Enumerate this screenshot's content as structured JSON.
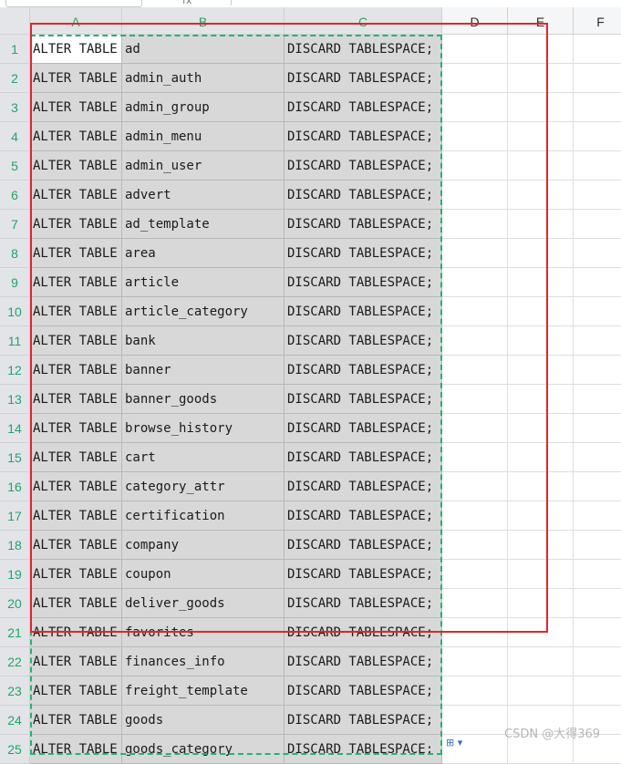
{
  "toolbar": {
    "name_box": "",
    "fx_label": "fx",
    "formula_value": ""
  },
  "columns": [
    "A",
    "B",
    "C",
    "D",
    "E",
    "F"
  ],
  "rows": [
    {
      "num": "1",
      "a": "ALTER TABLE",
      "b": "ad",
      "c": "DISCARD TABLESPACE;"
    },
    {
      "num": "2",
      "a": "ALTER TABLE",
      "b": "admin_auth",
      "c": "DISCARD TABLESPACE;"
    },
    {
      "num": "3",
      "a": "ALTER TABLE",
      "b": "admin_group",
      "c": "DISCARD TABLESPACE;"
    },
    {
      "num": "4",
      "a": "ALTER TABLE",
      "b": "admin_menu",
      "c": "DISCARD TABLESPACE;"
    },
    {
      "num": "5",
      "a": "ALTER TABLE",
      "b": "admin_user",
      "c": "DISCARD TABLESPACE;"
    },
    {
      "num": "6",
      "a": "ALTER TABLE",
      "b": "advert",
      "c": "DISCARD TABLESPACE;"
    },
    {
      "num": "7",
      "a": "ALTER TABLE",
      "b": "ad_template",
      "c": "DISCARD TABLESPACE;"
    },
    {
      "num": "8",
      "a": "ALTER TABLE",
      "b": "area",
      "c": "DISCARD TABLESPACE;"
    },
    {
      "num": "9",
      "a": "ALTER TABLE",
      "b": "article",
      "c": "DISCARD TABLESPACE;"
    },
    {
      "num": "10",
      "a": "ALTER TABLE",
      "b": "article_category",
      "c": "DISCARD TABLESPACE;"
    },
    {
      "num": "11",
      "a": "ALTER TABLE",
      "b": "bank",
      "c": "DISCARD TABLESPACE;"
    },
    {
      "num": "12",
      "a": "ALTER TABLE",
      "b": "banner",
      "c": "DISCARD TABLESPACE;"
    },
    {
      "num": "13",
      "a": "ALTER TABLE",
      "b": "banner_goods",
      "c": "DISCARD TABLESPACE;"
    },
    {
      "num": "14",
      "a": "ALTER TABLE",
      "b": "browse_history",
      "c": "DISCARD TABLESPACE;"
    },
    {
      "num": "15",
      "a": "ALTER TABLE",
      "b": "cart",
      "c": "DISCARD TABLESPACE;"
    },
    {
      "num": "16",
      "a": "ALTER TABLE",
      "b": "category_attr",
      "c": "DISCARD TABLESPACE;"
    },
    {
      "num": "17",
      "a": "ALTER TABLE",
      "b": "certification",
      "c": "DISCARD TABLESPACE;"
    },
    {
      "num": "18",
      "a": "ALTER TABLE",
      "b": "company",
      "c": "DISCARD TABLESPACE;"
    },
    {
      "num": "19",
      "a": "ALTER TABLE",
      "b": "coupon",
      "c": "DISCARD TABLESPACE;"
    },
    {
      "num": "20",
      "a": "ALTER TABLE",
      "b": "deliver_goods",
      "c": "DISCARD TABLESPACE;"
    },
    {
      "num": "21",
      "a": "ALTER TABLE",
      "b": "favorites",
      "c": "DISCARD TABLESPACE;"
    },
    {
      "num": "22",
      "a": "ALTER TABLE",
      "b": "finances_info",
      "c": "DISCARD TABLESPACE;"
    },
    {
      "num": "23",
      "a": "ALTER TABLE",
      "b": "freight_template",
      "c": "DISCARD TABLESPACE;"
    },
    {
      "num": "24",
      "a": "ALTER TABLE",
      "b": "goods",
      "c": "DISCARD TABLESPACE;"
    },
    {
      "num": "25",
      "a": "ALTER TABLE",
      "b": "goods_category",
      "c": "DISCARD TABLESPACE;"
    }
  ],
  "watermark": "CSDN @大得369",
  "colors": {
    "selection_accent": "#21b573",
    "annotation_box": "#e0262c",
    "selection_fill": "#d8d8d8"
  }
}
